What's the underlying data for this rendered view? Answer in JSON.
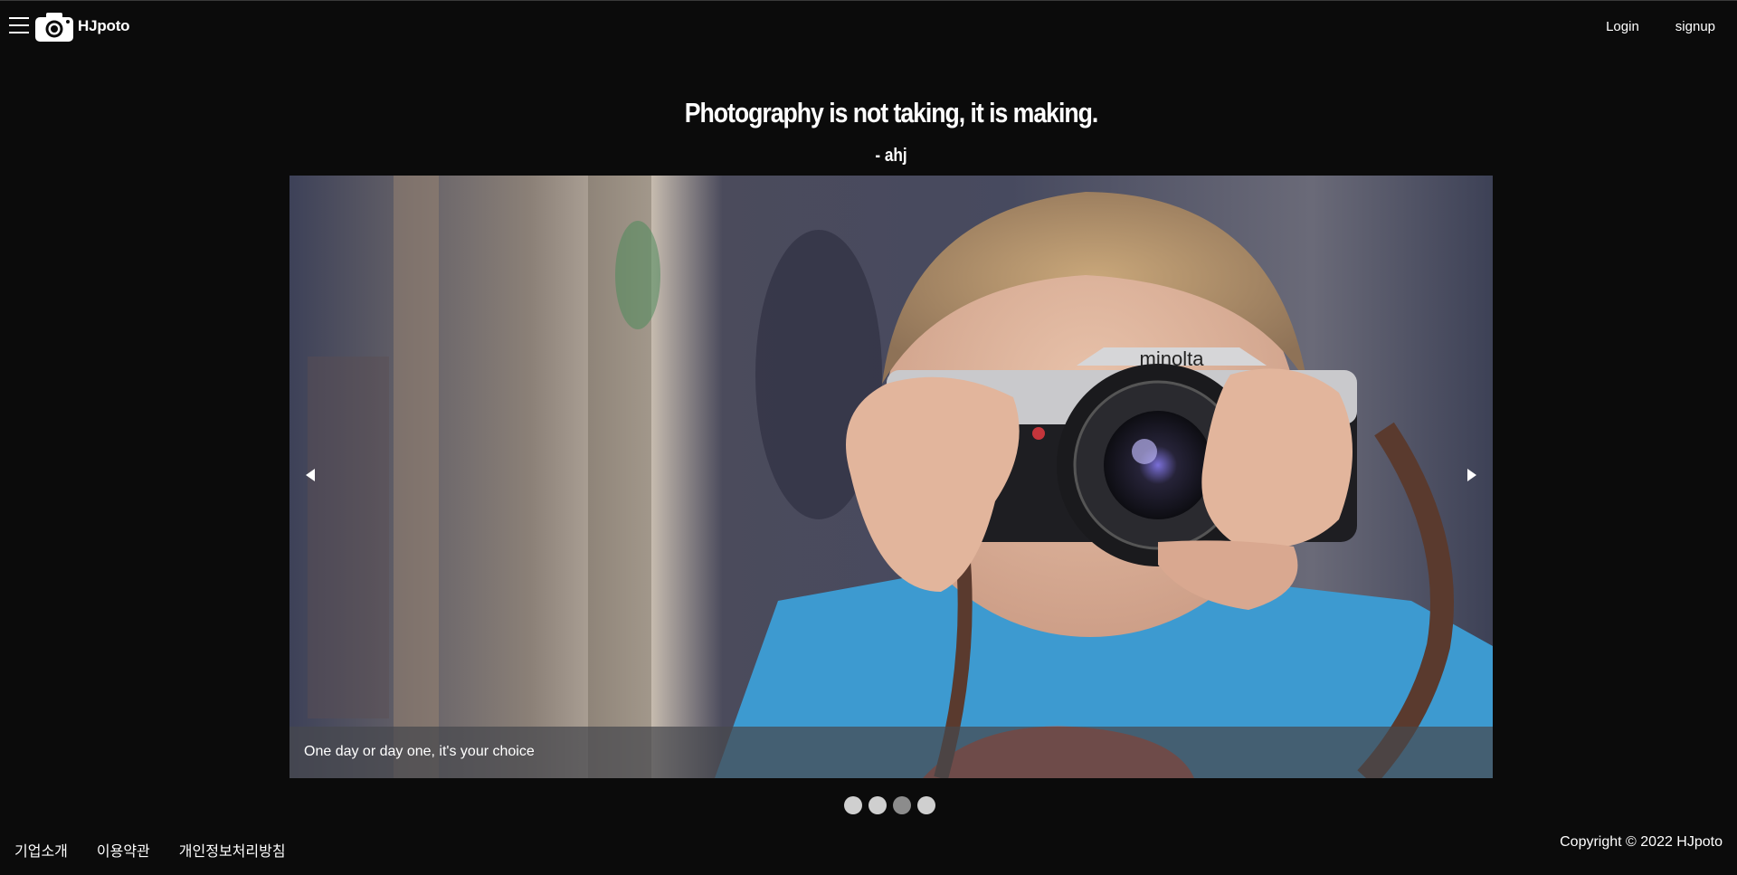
{
  "header": {
    "brand": "HJpoto",
    "login_label": "Login",
    "signup_label": "signup"
  },
  "hero": {
    "quote": "Photography is not taking, it is making.",
    "author": "- ahj"
  },
  "carousel": {
    "caption": "One day or day one, it's your choice",
    "image_subject": "child holding a minolta camera",
    "camera_brand_text": "minolta",
    "slide_count": 4,
    "active_slide": 3
  },
  "footer": {
    "links": [
      "기업소개",
      "이용약관",
      "개인정보처리방침"
    ],
    "copyright": "Copyright © 2022 HJpoto"
  },
  "colors": {
    "background": "#0b0b0b",
    "text": "#ffffff",
    "dot_inactive": "#cfcfcf",
    "dot_active": "#8c8c8c",
    "shirt": "#3d9ad0"
  },
  "icons": {
    "menu": "hamburger-icon",
    "logo": "camera-icon",
    "prev": "triangle-left-icon",
    "next": "triangle-right-icon"
  }
}
